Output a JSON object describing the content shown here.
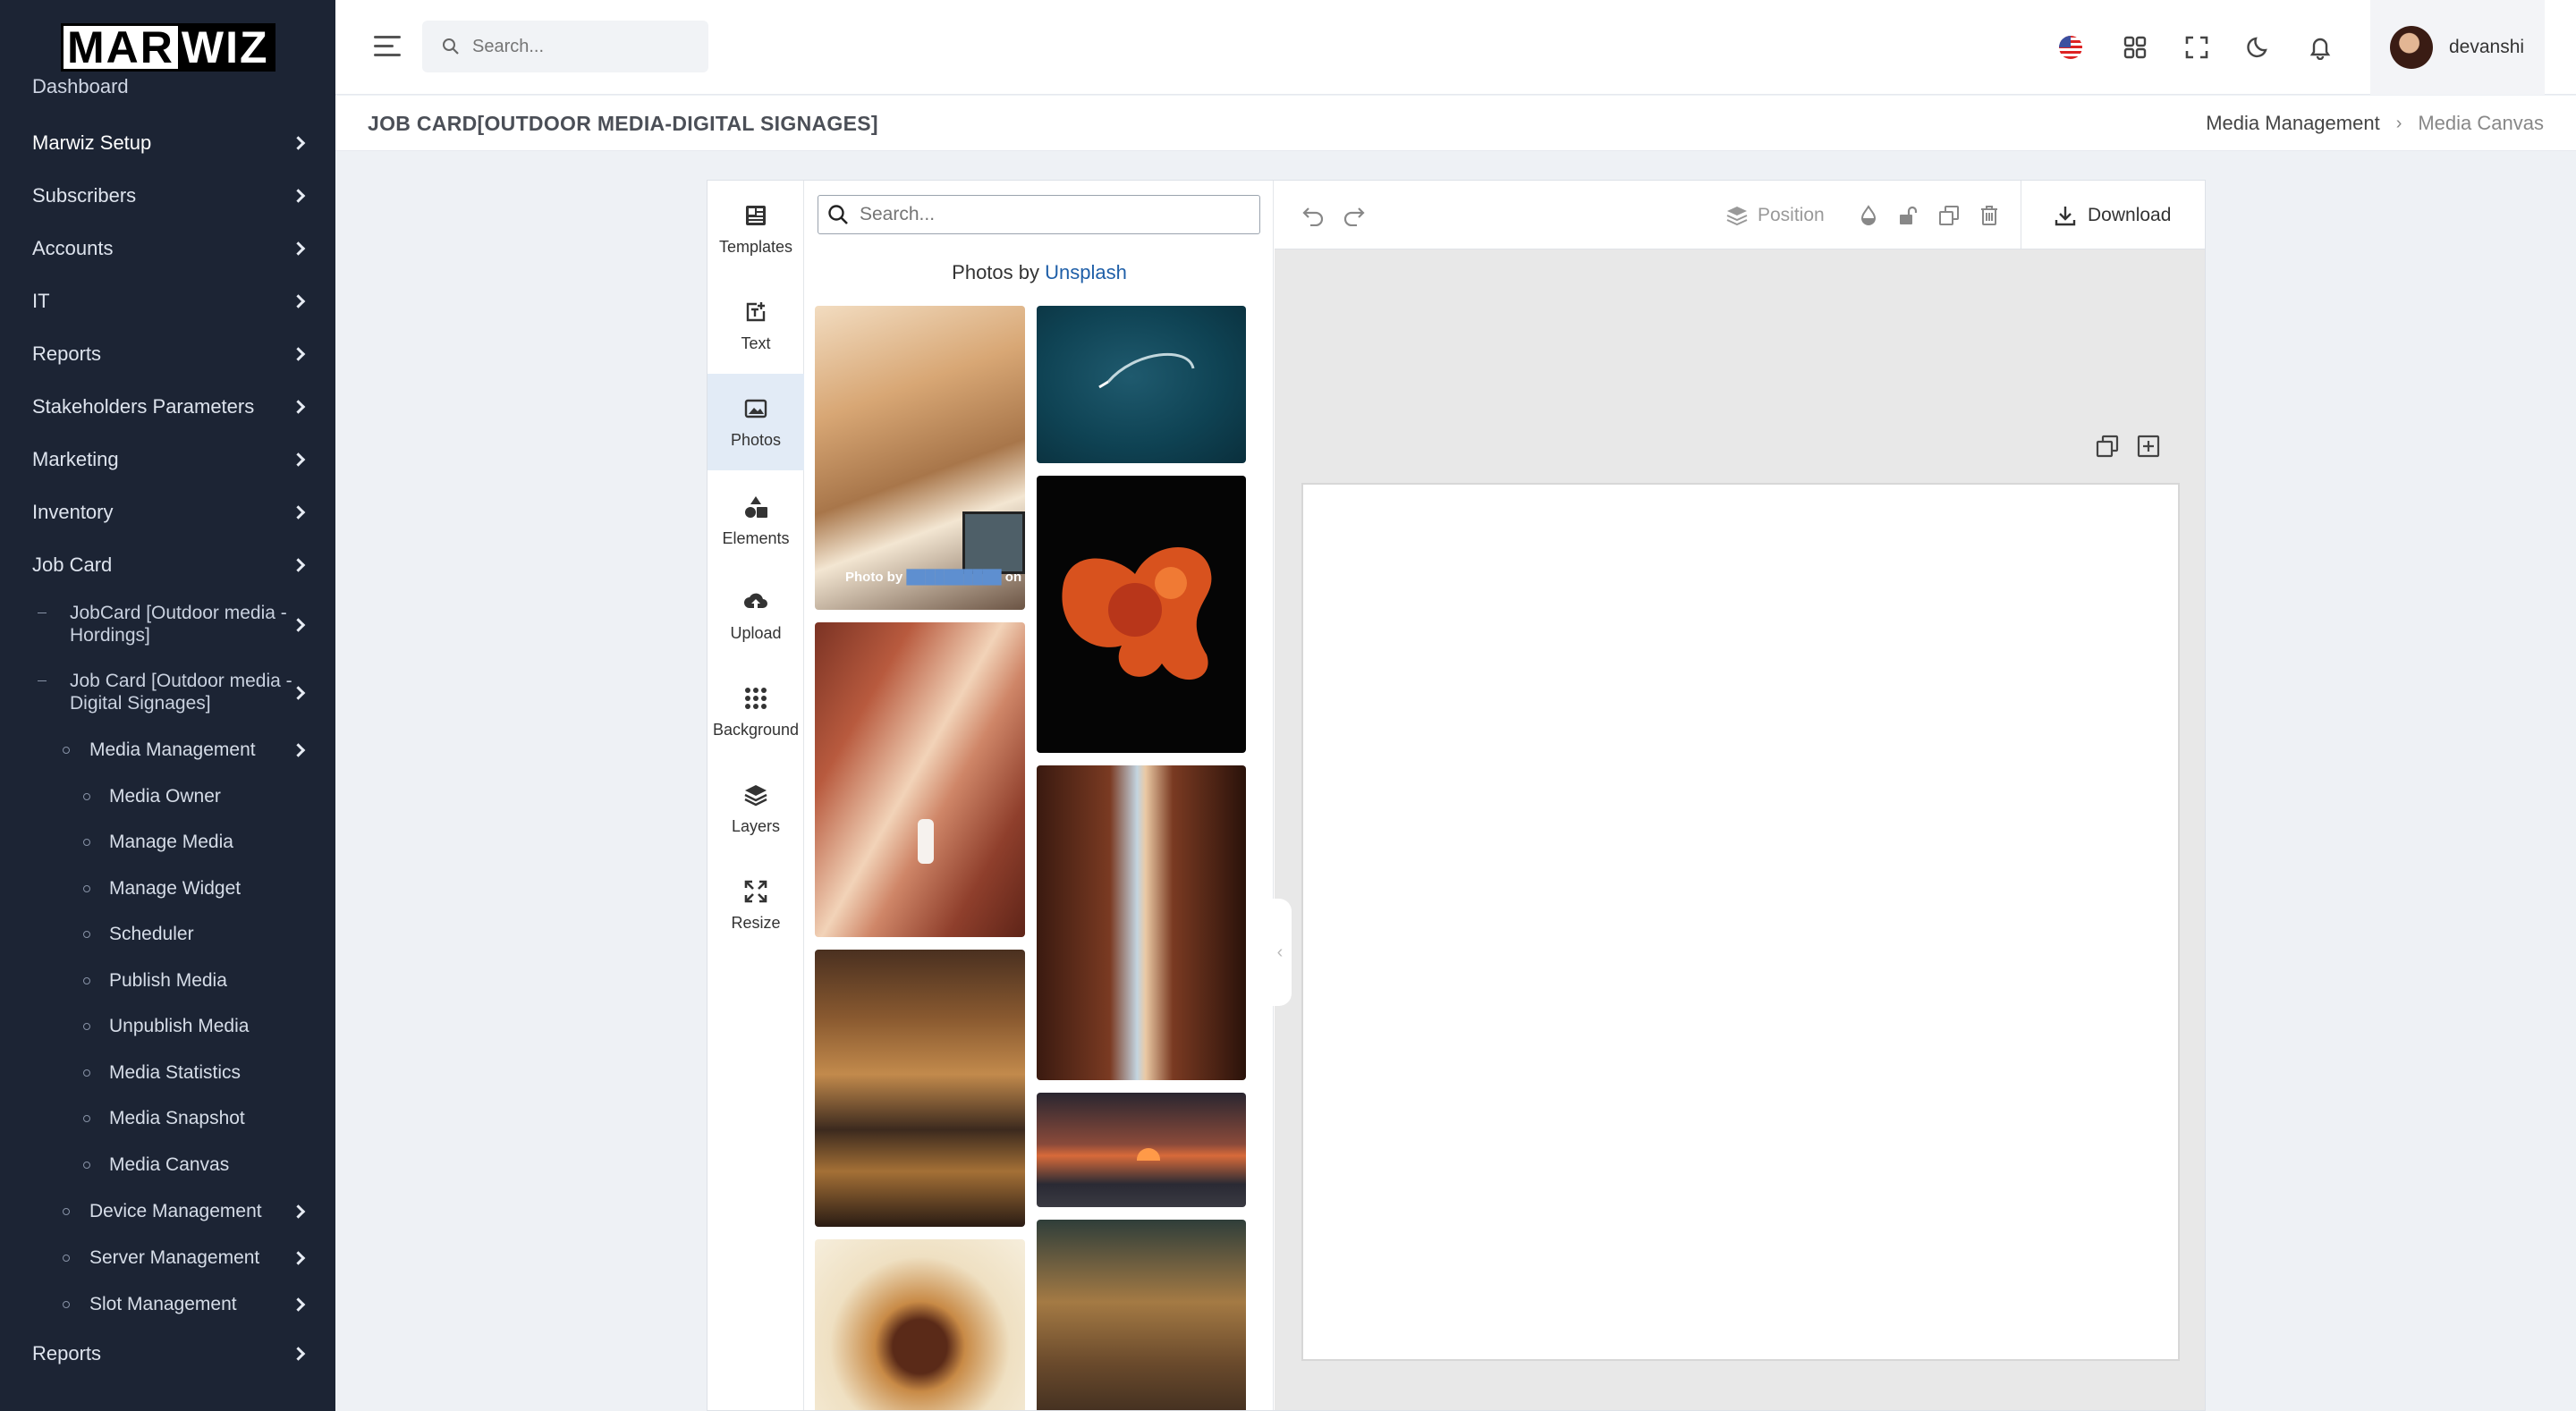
{
  "brand": {
    "logo_part1": "MAR",
    "logo_part2": "WIZ"
  },
  "sidebar": {
    "cut_item": "Dashboard",
    "items": [
      {
        "label": "Marwiz Setup"
      },
      {
        "label": "Subscribers"
      },
      {
        "label": "Accounts"
      },
      {
        "label": "IT"
      },
      {
        "label": "Reports"
      },
      {
        "label": "Stakeholders Parameters"
      },
      {
        "label": "Marketing"
      },
      {
        "label": "Inventory"
      },
      {
        "label": "Job Card"
      }
    ],
    "job_card_children": [
      {
        "label": "JobCard [Outdoor media - Hordings]"
      },
      {
        "label": "Job Card [Outdoor media - Digital Signages]"
      }
    ],
    "digital_children": [
      {
        "label": "Media Management"
      },
      {
        "label": "Device Management"
      },
      {
        "label": "Server Management"
      },
      {
        "label": "Slot Management"
      }
    ],
    "media_children": [
      {
        "label": "Media Owner"
      },
      {
        "label": "Manage Media"
      },
      {
        "label": "Manage Widget"
      },
      {
        "label": "Scheduler"
      },
      {
        "label": "Publish Media"
      },
      {
        "label": "Unpublish Media"
      },
      {
        "label": "Media Statistics"
      },
      {
        "label": "Media Snapshot"
      },
      {
        "label": "Media Canvas"
      }
    ],
    "bottom_item": {
      "label": "Reports"
    }
  },
  "header": {
    "search_placeholder": "Search...",
    "username": "devanshi",
    "flag": "us-flag-icon"
  },
  "page": {
    "title": "JOB CARD[OUTDOOR MEDIA-DIGITAL SIGNAGES]",
    "breadcrumb": [
      "Media Management",
      "Media Canvas"
    ]
  },
  "editor": {
    "tools": [
      {
        "label": "Templates",
        "icon": "templates-icon"
      },
      {
        "label": "Text",
        "icon": "text-icon"
      },
      {
        "label": "Photos",
        "icon": "photos-icon",
        "active": true
      },
      {
        "label": "Elements",
        "icon": "elements-icon"
      },
      {
        "label": "Upload",
        "icon": "upload-icon"
      },
      {
        "label": "Background",
        "icon": "background-icon"
      },
      {
        "label": "Layers",
        "icon": "layers-icon"
      },
      {
        "label": "Resize",
        "icon": "resize-icon"
      }
    ],
    "photo_search_placeholder": "Search...",
    "credit_prefix": "Photos by",
    "credit_link": "Unsplash",
    "photo_overlay_prefix": "Photo by",
    "photo_overlay_suffix": "on",
    "toolbar": {
      "position_label": "Position",
      "download_label": "Download"
    }
  },
  "colors": {
    "sidebar_bg": "#1c2434",
    "accent_link": "#1f5fa8",
    "active_tool_bg": "#e2ebf6"
  }
}
